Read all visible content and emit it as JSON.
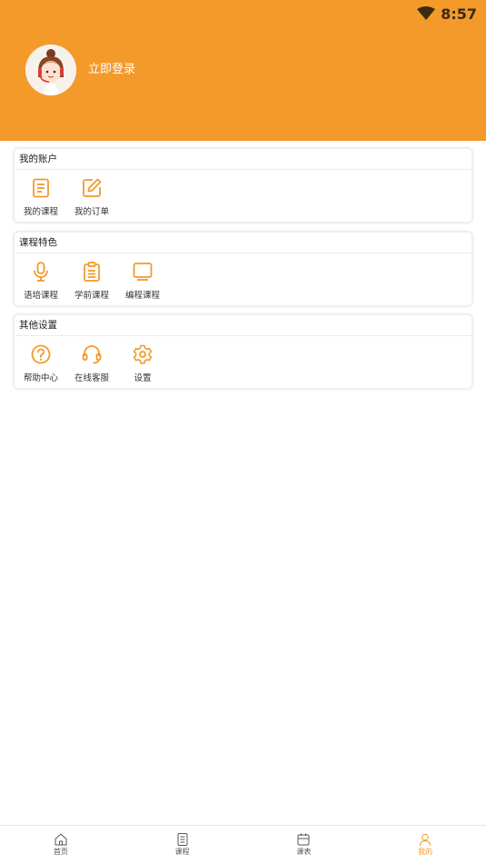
{
  "status_bar": {
    "time": "8:57",
    "wifi_icon": "wifi-icon"
  },
  "profile": {
    "avatar_icon": "avatar-girl-headset",
    "login_label": "立即登录"
  },
  "sections": [
    {
      "title": "我的账户",
      "items": [
        {
          "label": "我的课程",
          "icon": "document-icon"
        },
        {
          "label": "我的订单",
          "icon": "edit-icon"
        }
      ]
    },
    {
      "title": "课程特色",
      "items": [
        {
          "label": "语培课程",
          "icon": "microphone-icon"
        },
        {
          "label": "学前课程",
          "icon": "clipboard-icon"
        },
        {
          "label": "编程课程",
          "icon": "monitor-icon"
        }
      ]
    },
    {
      "title": "其他设置",
      "items": [
        {
          "label": "帮助中心",
          "icon": "help-icon"
        },
        {
          "label": "在线客服",
          "icon": "headset-icon"
        },
        {
          "label": "设置",
          "icon": "gear-icon"
        }
      ]
    }
  ],
  "tabbar": {
    "active_index": 3,
    "tabs": [
      {
        "label": "首页",
        "icon": "home-icon"
      },
      {
        "label": "课程",
        "icon": "book-icon"
      },
      {
        "label": "课表",
        "icon": "schedule-icon"
      },
      {
        "label": "我的",
        "icon": "user-icon"
      }
    ]
  },
  "colors": {
    "accent": "#f39a2b",
    "header_bg": "#f39a2b",
    "icon": "#f39a2b",
    "text": "#333333"
  }
}
